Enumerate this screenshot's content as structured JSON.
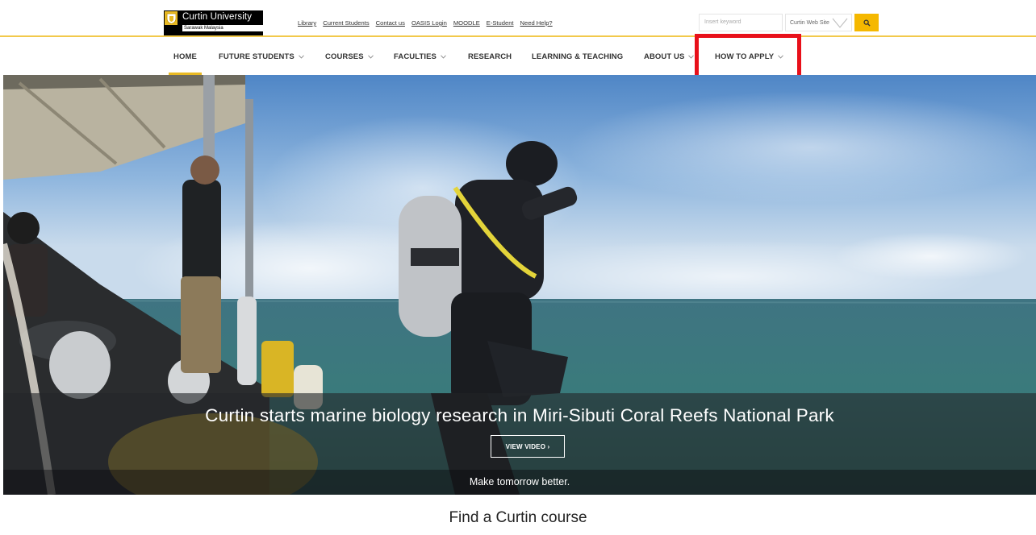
{
  "brand": {
    "name": "Curtin University",
    "campus": "Sarawak Malaysia"
  },
  "utility_links": [
    "Library",
    "Current Students",
    "Contact us",
    "OASIS Login",
    "MOODLE",
    "E-Student",
    "Need Help?"
  ],
  "search": {
    "placeholder": "Insert keyword",
    "scope": "Curtin Web Site"
  },
  "nav": {
    "items": [
      {
        "label": "HOME",
        "dropdown": false,
        "active": true
      },
      {
        "label": "FUTURE STUDENTS",
        "dropdown": true,
        "active": false
      },
      {
        "label": "COURSES",
        "dropdown": true,
        "active": false
      },
      {
        "label": "FACULTIES",
        "dropdown": true,
        "active": false
      },
      {
        "label": "RESEARCH",
        "dropdown": false,
        "active": false
      },
      {
        "label": "LEARNING & TEACHING",
        "dropdown": false,
        "active": false
      },
      {
        "label": "ABOUT US",
        "dropdown": true,
        "active": false
      },
      {
        "label": "HOW TO APPLY",
        "dropdown": true,
        "active": false
      }
    ],
    "highlighted_item": "HOW TO APPLY"
  },
  "hero": {
    "title": "Curtin starts marine biology research in Miri-Sibuti Coral Reefs National Park",
    "button_label": "VIEW VIDEO ›",
    "tagline": "Make tomorrow better."
  },
  "sections": {
    "find_course_title": "Find a Curtin course"
  },
  "colors": {
    "accent": "#f5b800",
    "nav_underline": "#e8b923",
    "highlight_annotation": "#e8101a"
  }
}
